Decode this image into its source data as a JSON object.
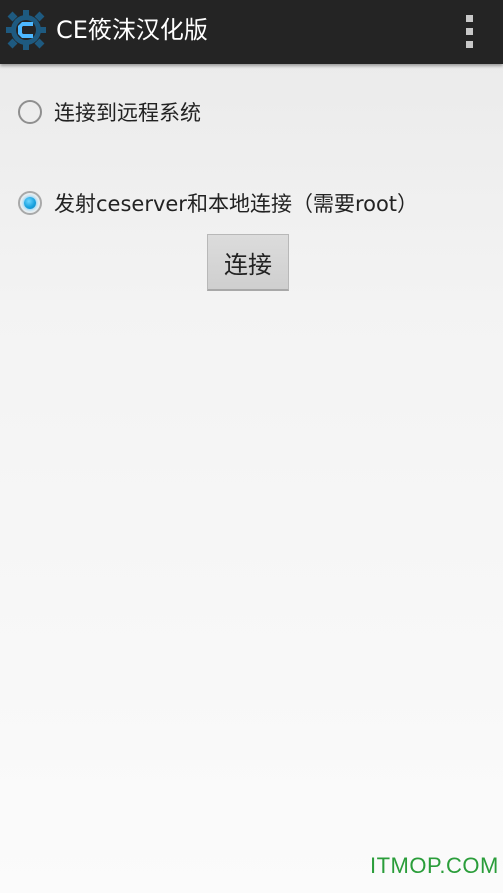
{
  "action_bar": {
    "title": "CE筱沫汉化版",
    "app_icon": "cheat-engine-gear-icon",
    "overflow_icon": "overflow-menu-icon"
  },
  "options": [
    {
      "label": "连接到远程系统",
      "checked": false
    },
    {
      "label": "发射ceserver和本地连接（需要root）",
      "checked": true
    }
  ],
  "connect_button": {
    "label": "连接"
  },
  "watermark": {
    "text": "ITMOP.COM"
  },
  "colors": {
    "action_bar": "#242424",
    "radio_accent": "#1aa3e0",
    "watermark": "#2a9d3a"
  }
}
